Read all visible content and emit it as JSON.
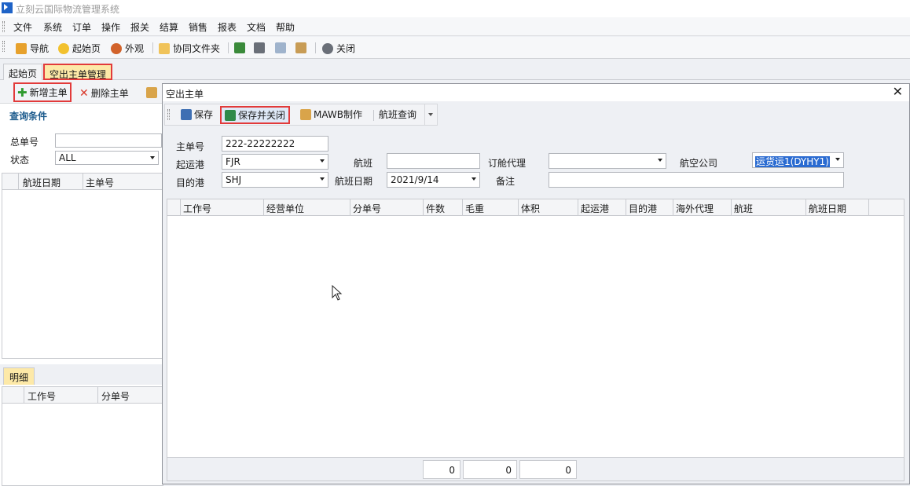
{
  "app": {
    "title": "立刻云国际物流管理系统"
  },
  "menu": [
    "文件",
    "系统",
    "订单",
    "操作",
    "报关",
    "结算",
    "销售",
    "报表",
    "文档",
    "帮助"
  ],
  "toolbar": {
    "nav": "导航",
    "home": "起始页",
    "appearance": "外观",
    "shared_folder": "协同文件夹",
    "close": "关闭"
  },
  "tabs": {
    "start": "起始页",
    "air_master": "空出主单管理"
  },
  "left": {
    "new_master": "新增主单",
    "delete_master": "删除主单",
    "query_section": "查询条件",
    "master_no_label": "总单号",
    "master_no_value": "",
    "status_label": "状态",
    "status_value": "ALL",
    "grid_cols": [
      "航班日期",
      "主单号"
    ],
    "detail_tab": "明细",
    "detail_cols": [
      "工作号",
      "分单号"
    ]
  },
  "dialog": {
    "title": "空出主单",
    "save": "保存",
    "save_close": "保存并关闭",
    "mawb": "MAWB制作",
    "flight_query": "航班查询",
    "fields": {
      "master_no_label": "主单号",
      "master_no": "222-22222222",
      "origin_label": "起运港",
      "origin": "FJR",
      "flight_label": "航班",
      "flight": "",
      "booking_agent_label": "订舱代理",
      "booking_agent": "",
      "airline_label": "航空公司",
      "airline": "运货运1(DYHY1)",
      "dest_label": "目的港",
      "dest": "SHJ",
      "flight_date_label": "航班日期",
      "flight_date": "2021/9/14",
      "remark_label": "备注",
      "remark": ""
    },
    "grid_cols": [
      "工作号",
      "经营单位",
      "分单号",
      "件数",
      "毛重",
      "体积",
      "起运港",
      "目的港",
      "海外代理",
      "航班",
      "航班日期"
    ],
    "totals": {
      "pieces": "0",
      "weight": "0",
      "volume": "0"
    }
  },
  "colors": {
    "highlight_border": "#e23a3a",
    "active_tab": "#fde9a8",
    "section_title": "#1b5a8c",
    "selection": "#2a6bd1"
  }
}
